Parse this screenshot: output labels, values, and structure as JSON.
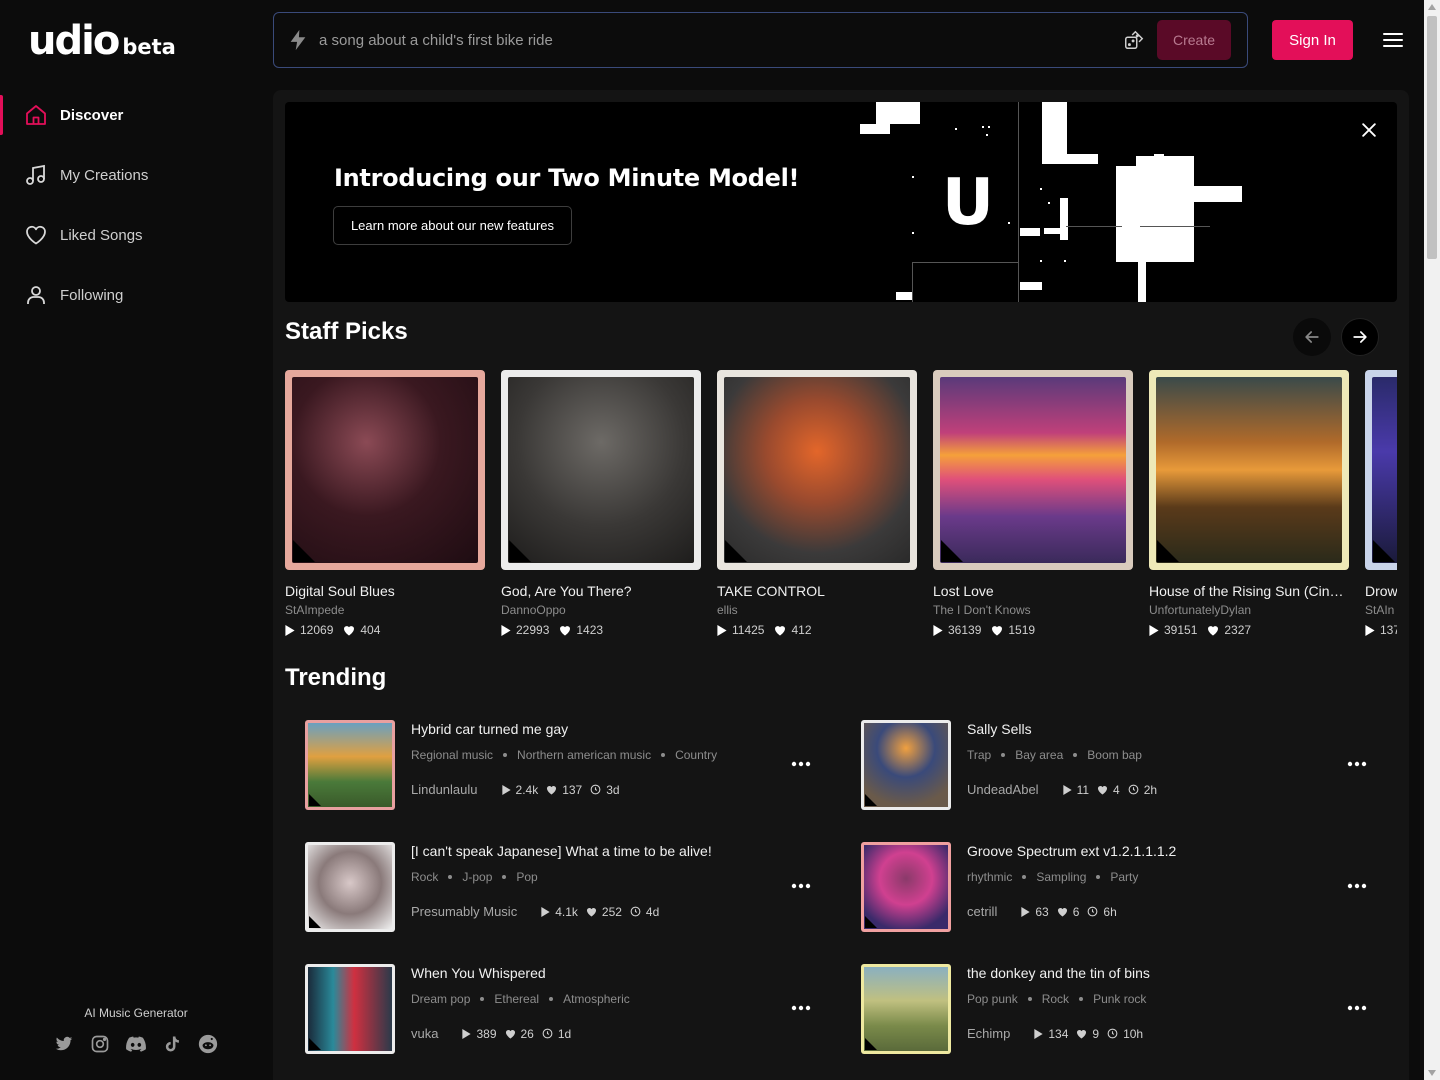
{
  "brand": {
    "logo": "udio",
    "badge": "beta"
  },
  "nav": [
    {
      "label": "Discover",
      "icon": "home-icon",
      "active": true
    },
    {
      "label": "My Creations",
      "icon": "music-note-icon",
      "active": false
    },
    {
      "label": "Liked Songs",
      "icon": "heart-icon",
      "active": false
    },
    {
      "label": "Following",
      "icon": "user-icon",
      "active": false
    }
  ],
  "footer": {
    "label": "AI Music Generator",
    "socials": [
      "twitter-icon",
      "instagram-icon",
      "discord-icon",
      "tiktok-icon",
      "reddit-icon"
    ]
  },
  "search": {
    "placeholder": "a song about a child's first bike ride",
    "create_label": "Create"
  },
  "header": {
    "signin_label": "Sign In"
  },
  "banner": {
    "title": "Introducing our Two Minute Model!",
    "button_label": "Learn more about our new features"
  },
  "staff_picks": {
    "title": "Staff Picks",
    "items": [
      {
        "title": "Digital Soul Blues",
        "artist": "StAImpede",
        "plays": "12069",
        "likes": "404"
      },
      {
        "title": "God, Are You There?",
        "artist": "DannoOppo",
        "plays": "22993",
        "likes": "1423"
      },
      {
        "title": "TAKE CONTROL",
        "artist": "ellis",
        "plays": "11425",
        "likes": "412"
      },
      {
        "title": "Lost Love",
        "artist": "The I Don't Knows",
        "plays": "36139",
        "likes": "1519"
      },
      {
        "title": "House of the Rising Sun (Cinem...",
        "artist": "UnfortunatelyDylan",
        "plays": "39151",
        "likes": "2327"
      },
      {
        "title": "Drow",
        "artist": "StAIn",
        "plays": "137",
        "likes": ""
      }
    ]
  },
  "trending": {
    "title": "Trending",
    "items": [
      {
        "title": "Hybrid car turned me gay",
        "tags": [
          "Regional music",
          "Northern american music",
          "Country"
        ],
        "artist": "Lindunlaulu",
        "plays": "2.4k",
        "likes": "137",
        "age": "3d"
      },
      {
        "title": "Sally Sells",
        "tags": [
          "Trap",
          "Bay area",
          "Boom bap"
        ],
        "artist": "UndeadAbel",
        "plays": "11",
        "likes": "4",
        "age": "2h"
      },
      {
        "title": "[I can't speak Japanese] What a time to be alive!",
        "tags": [
          "Rock",
          "J-pop",
          "Pop"
        ],
        "artist": "Presumably Music",
        "plays": "4.1k",
        "likes": "252",
        "age": "4d"
      },
      {
        "title": "Groove Spectrum ext v1.2.1.1.1.2",
        "tags": [
          "rhythmic",
          "Sampling",
          "Party"
        ],
        "artist": "cetrill",
        "plays": "63",
        "likes": "6",
        "age": "6h"
      },
      {
        "title": "When You Whispered",
        "tags": [
          "Dream pop",
          "Ethereal",
          "Atmospheric"
        ],
        "artist": "vuka",
        "plays": "389",
        "likes": "26",
        "age": "1d"
      },
      {
        "title": "the donkey and the tin of bins",
        "tags": [
          "Pop punk",
          "Rock",
          "Punk rock"
        ],
        "artist": "Echimp",
        "plays": "134",
        "likes": "9",
        "age": "10h"
      }
    ]
  },
  "colors": {
    "accent": "#e30f59",
    "background": "#0c0c0c",
    "panel": "#141414",
    "search_border": "#3a4a7a"
  }
}
